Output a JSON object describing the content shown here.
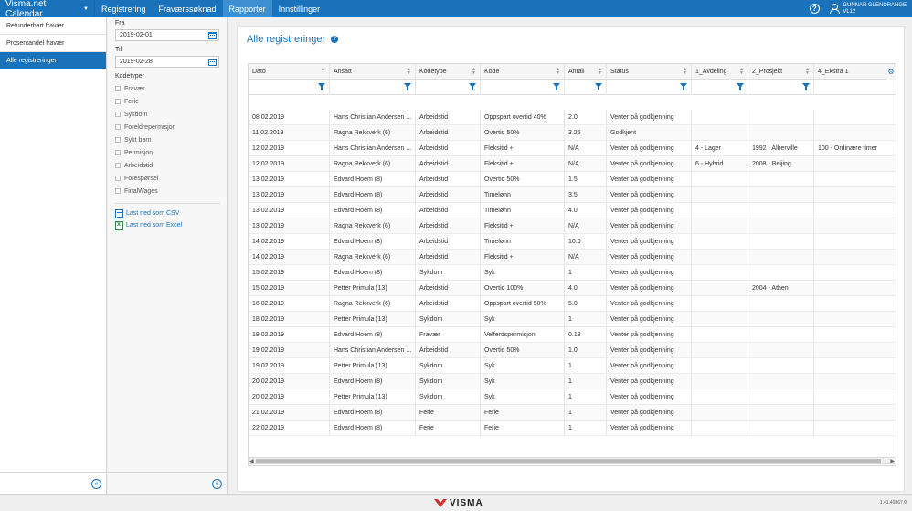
{
  "app": {
    "brand": "Visma.net Calendar",
    "nav": [
      {
        "label": "Registrering",
        "active": false
      },
      {
        "label": "Fraværssøknad",
        "active": false
      },
      {
        "label": "Rapporter",
        "active": true
      },
      {
        "label": "Innstillinger",
        "active": false
      }
    ],
    "help_icon": "?",
    "user": {
      "name": "GUNNAR GLENDRANGE",
      "code": "VL12"
    }
  },
  "sidebar": {
    "items": [
      {
        "label": "Refunderbart fravær",
        "active": false
      },
      {
        "label": "Prosentandel fravær",
        "active": false
      },
      {
        "label": "Alle registreringer",
        "active": true
      }
    ],
    "collapse_icon": "«"
  },
  "filters": {
    "from_label": "Fra",
    "from_value": "2019-02-01",
    "to_label": "Til",
    "to_value": "2019-02-28",
    "codetypes_label": "Kodetyper",
    "codetypes": [
      "Fravær",
      "Ferie",
      "Sykdom",
      "Foreldrepermisjon",
      "Sykt barn",
      "Permisjon",
      "Arbeidstid",
      "Forespørsel",
      "FinalWages"
    ],
    "download_csv": "Last ned som CSV",
    "download_excel": "Last ned som Excel",
    "collapse_icon": "«"
  },
  "report": {
    "title": "Alle registreringer",
    "info_icon": "?",
    "gear_icon": "⚙",
    "columns": [
      "Dato",
      "Ansatt",
      "Kodetype",
      "Kode",
      "Antall",
      "Status",
      "1_Avdeling",
      "2_Prosjekt",
      "4_Ekstra 1"
    ],
    "rows": [
      [
        "08.02.2019",
        "Hans Christian Andersen ...",
        "Arbeidstid",
        "Oppspart overtid 40%",
        "2.0",
        "Venter på godkjenning",
        "",
        "",
        ""
      ],
      [
        "11.02.2019",
        "Ragna Rekkverk (6)",
        "Arbeidstid",
        "Overtid 50%",
        "3.25",
        "Godkjent",
        "",
        "",
        ""
      ],
      [
        "12.02.2019",
        "Hans Christian Andersen ...",
        "Arbeidstid",
        "Fleksitid +",
        "N/A",
        "Venter på godkjenning",
        "4 - Lager",
        "1992 - Alberville",
        "100 - Ordinære timer"
      ],
      [
        "12.02.2019",
        "Ragna Rekkverk (6)",
        "Arbeidstid",
        "Fleksitid +",
        "N/A",
        "Venter på godkjenning",
        "6 - Hybrid",
        "2008 - Beijing",
        ""
      ],
      [
        "13.02.2019",
        "Edvard Hoem (8)",
        "Arbeidstid",
        "Overtid 50%",
        "1.5",
        "Venter på godkjenning",
        "",
        "",
        ""
      ],
      [
        "13.02.2019",
        "Edvard Hoem (8)",
        "Arbeidstid",
        "Timelønn",
        "3.5",
        "Venter på godkjenning",
        "",
        "",
        ""
      ],
      [
        "13.02.2019",
        "Edvard Hoem (8)",
        "Arbeidstid",
        "Timelønn",
        "4.0",
        "Venter på godkjenning",
        "",
        "",
        ""
      ],
      [
        "13.02.2019",
        "Ragna Rekkverk (6)",
        "Arbeidstid",
        "Fleksitid +",
        "N/A",
        "Venter på godkjenning",
        "",
        "",
        ""
      ],
      [
        "14.02.2019",
        "Edvard Hoem (8)",
        "Arbeidstid",
        "Timelønn",
        "10.0",
        "Venter på godkjenning",
        "",
        "",
        ""
      ],
      [
        "14.02.2019",
        "Ragna Rekkverk (6)",
        "Arbeidstid",
        "Fleksitid +",
        "N/A",
        "Venter på godkjenning",
        "",
        "",
        ""
      ],
      [
        "15.02.2019",
        "Edvard Hoem (8)",
        "Sykdom",
        "Syk",
        "1",
        "Venter på godkjenning",
        "",
        "",
        ""
      ],
      [
        "15.02.2019",
        "Petter Primula (13)",
        "Arbeidstid",
        "Overtid 100%",
        "4.0",
        "Venter på godkjenning",
        "",
        "2004 - Athen",
        ""
      ],
      [
        "16.02.2019",
        "Ragna Rekkverk (6)",
        "Arbeidstid",
        "Oppspart overtid 50%",
        "5.0",
        "Venter på godkjenning",
        "",
        "",
        ""
      ],
      [
        "18.02.2019",
        "Petter Primula (13)",
        "Sykdom",
        "Syk",
        "1",
        "Venter på godkjenning",
        "",
        "",
        ""
      ],
      [
        "19.02.2019",
        "Edvard Hoem (8)",
        "Fravær",
        "Velferdspermisjon",
        "0.13",
        "Venter på godkjenning",
        "",
        "",
        ""
      ],
      [
        "19.02.2019",
        "Hans Christian Andersen ...",
        "Arbeidstid",
        "Overtid 50%",
        "1.0",
        "Venter på godkjenning",
        "",
        "",
        ""
      ],
      [
        "19.02.2019",
        "Petter Primula (13)",
        "Sykdom",
        "Syk",
        "1",
        "Venter på godkjenning",
        "",
        "",
        ""
      ],
      [
        "20.02.2019",
        "Edvard Hoem (8)",
        "Sykdom",
        "Syk",
        "1",
        "Venter på godkjenning",
        "",
        "",
        ""
      ],
      [
        "20.02.2019",
        "Petter Primula (13)",
        "Sykdom",
        "Syk",
        "1",
        "Venter på godkjenning",
        "",
        "",
        ""
      ],
      [
        "21.02.2019",
        "Edvard Hoem (8)",
        "Ferie",
        "Ferie",
        "1",
        "Venter på godkjenning",
        "",
        "",
        ""
      ],
      [
        "22.02.2019",
        "Edvard Hoem (8)",
        "Ferie",
        "Ferie",
        "1",
        "Venter på godkjenning",
        "",
        "",
        ""
      ]
    ]
  },
  "footer": {
    "logo_text": "VISMA",
    "version": "1.41.49367.0",
    "brand_color": "#d32f2f"
  },
  "colors": {
    "accent": "#1a73ba",
    "active_nav": "#3d8fd0"
  }
}
